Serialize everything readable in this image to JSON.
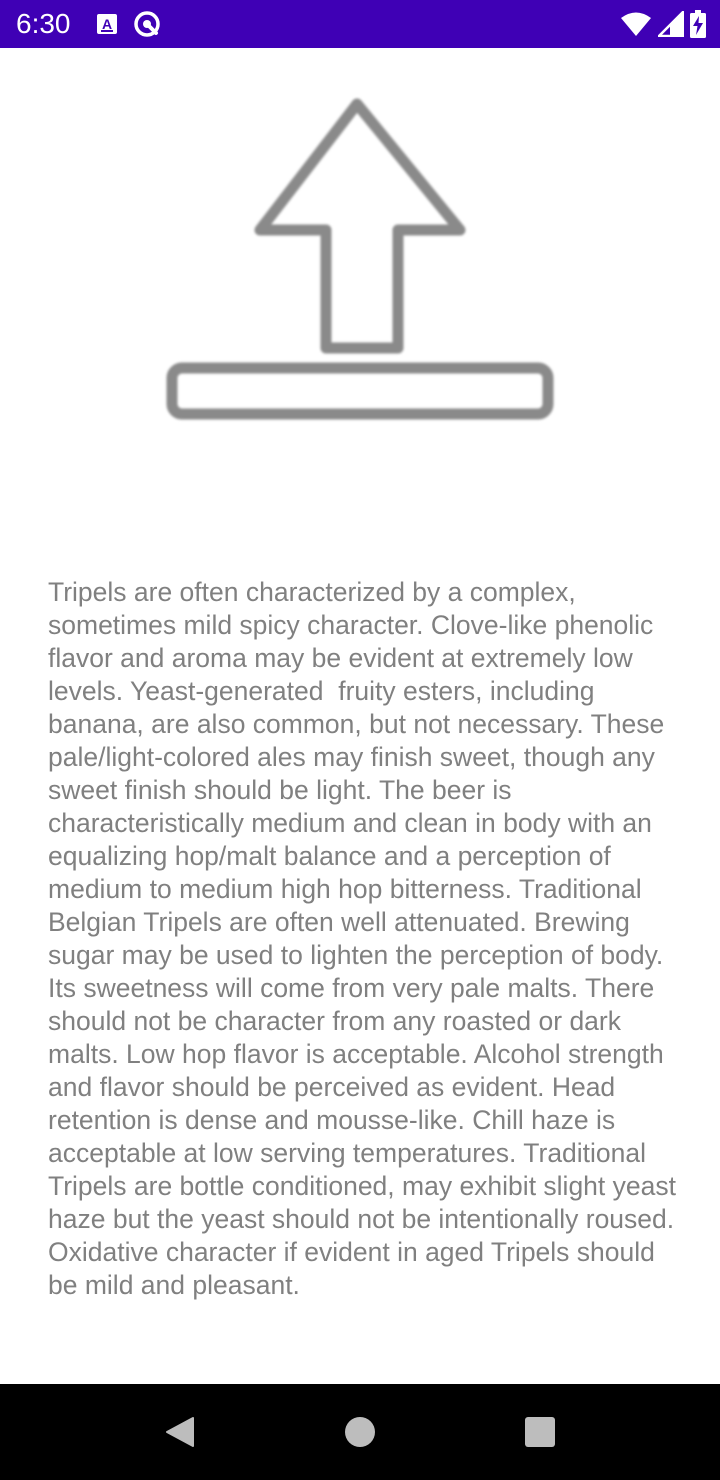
{
  "status_bar": {
    "time": "6:30",
    "background": "#3f00b5",
    "left_icons": [
      "notification-a-icon",
      "sync-circle-icon"
    ],
    "right_icons": [
      "wifi-icon",
      "cellular-signal-icon",
      "battery-charging-icon"
    ]
  },
  "content": {
    "image_icon": "upload-arrow-icon",
    "description": "Tripels are often characterized by a complex, sometimes mild spicy character. Clove-like phenolic flavor and aroma may be evident at extremely low levels. Yeast-generated  fruity esters, including banana, are also common, but not necessary. These pale/light-colored ales may finish sweet, though any sweet finish should be light. The beer is characteristically medium and clean in body with an equalizing hop/malt balance and a perception of medium to medium high hop bitterness. Traditional Belgian Tripels are often well attenuated. Brewing sugar may be used to lighten the perception of body. Its sweetness will come from very pale malts. There should not be character from any roasted or dark malts. Low hop flavor is acceptable. Alcohol strength and flavor should be perceived as evident. Head retention is dense and mousse-like. Chill haze is acceptable at low serving temperatures. Traditional Tripels are bottle conditioned, may exhibit slight yeast haze but the yeast should not be intentionally roused. Oxidative character if evident in aged Tripels should be mild and pleasant.",
    "text_color": "#808080"
  },
  "nav_bar": {
    "buttons": [
      "back-icon",
      "home-icon",
      "recents-icon"
    ]
  }
}
